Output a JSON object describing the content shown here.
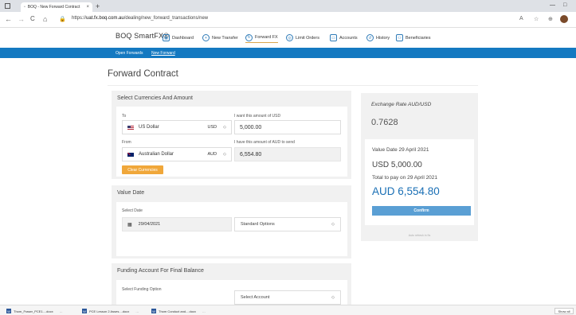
{
  "browser": {
    "tab_title": "BOQ - New Forward Contract",
    "tab_close": "×",
    "new_tab": "+",
    "url_prefix": "https://",
    "url_domain": "uat.fx.boq.com.au",
    "url_path": "/dealing/new_forward_transactions/new",
    "back": "←",
    "forward": "→",
    "reload": "C",
    "home": "⌂",
    "minimize": "—",
    "maximize": "□"
  },
  "app": {
    "brand": "BOQ SmartFX®",
    "nav": [
      {
        "label": "Dashboard",
        "icon": "▦"
      },
      {
        "label": "New Transfer",
        "icon": "+"
      },
      {
        "label": "Forward FX",
        "icon": "↻"
      },
      {
        "label": "Limit Orders",
        "icon": "◎"
      },
      {
        "label": "Accounts",
        "icon": "▭"
      },
      {
        "label": "History",
        "icon": "↺"
      },
      {
        "label": "Beneficiaries",
        "icon": "⚇"
      }
    ],
    "subnav": {
      "open_forwards": "Open Forwards",
      "new_forward": "New Forward"
    }
  },
  "page": {
    "title": "Forward Contract"
  },
  "currencies": {
    "title": "Select Currencies And Amount",
    "to_label": "To",
    "to_currency": "US Dollar",
    "to_code": "USD",
    "want_label": "I want this amount of USD",
    "want_amount": "5,000.00",
    "from_label": "From",
    "from_currency": "Australian Dollar",
    "from_code": "AUD",
    "send_label": "I have this amount of AUD to send",
    "send_amount": "6,554.80",
    "clear_button": "Clear Currencies"
  },
  "value_date": {
    "title": "Value Date",
    "select_label": "Select Date",
    "date": "29/04/2021",
    "option": "Standard Options"
  },
  "funding": {
    "title": "Funding Account For Final Balance",
    "select_label": "Select Funding Option",
    "account_placeholder": "Select Account"
  },
  "rate": {
    "title": "Exchange Rate AUD/USD",
    "value": "0.7628",
    "value_date": "Value Date 29 April 2021",
    "buy_amount": "USD 5,000.00",
    "total_label": "Total to pay on 29 April 2021",
    "total_amount": "AUD 6,554.80",
    "confirm_button": "Confirm",
    "note": "Auto refresh in 9s"
  },
  "downloads": {
    "items": [
      "Thom_Fraser_PCE1....docx",
      "PCE Lesson 2 Asses....docx",
      "Thom Conduct and....docx"
    ],
    "show_all": "Show all"
  }
}
